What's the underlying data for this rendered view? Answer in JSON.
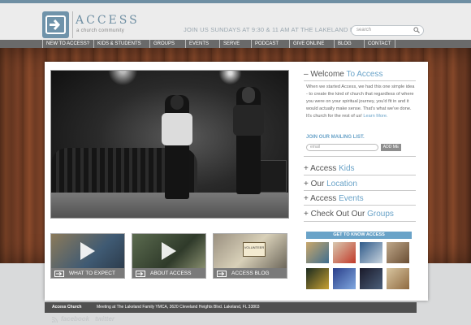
{
  "brand": {
    "name": "ACCESS",
    "subtitle": "a church community",
    "color": "#6f8fa3"
  },
  "header": {
    "tagline": "JOIN US SUNDAYS AT 9:30 & 11 AM AT THE LAKELAND FAMILY YMCA"
  },
  "search": {
    "placeholder": "search",
    "icon": "magnifier-icon"
  },
  "nav": [
    "NEW TO ACCESS?",
    "KIDS & STUDENTS",
    "GROUPS",
    "EVENTS",
    "SERVE",
    "PODCAST",
    "GIVE ONLINE",
    "BLOG",
    "CONTACT"
  ],
  "thumbs": [
    {
      "label": "WHAT TO EXPECT",
      "icon": "arrow-icon",
      "play": true
    },
    {
      "label": "ABOUT ACCESS",
      "icon": "arrow-icon",
      "play": true
    },
    {
      "label": "ACCESS BLOG",
      "icon": "arrow-icon",
      "badge": "VOLUNTEER"
    }
  ],
  "welcome": {
    "prefix": "– Welcome ",
    "accent": "To Access"
  },
  "intro": {
    "text": "When we started Access, we had this one simple idea - to create the kind of church that regardless of where you were on your spiritual journey, you'd fit in and it would actually make sense. That's what we've done. It's church for the rest of us!",
    "link": "Learn More."
  },
  "mailing": {
    "label": "JOIN OUR MAILING LIST.",
    "placeholder": "email",
    "button": "ADD ME"
  },
  "accordion": [
    {
      "prefix": "+ Access ",
      "accent": "Kids"
    },
    {
      "prefix": "+ Our ",
      "accent": "Location"
    },
    {
      "prefix": "+ Access ",
      "accent": "Events"
    },
    {
      "prefix": "+ Check Out Our ",
      "accent": "Groups"
    }
  ],
  "get_to_know": {
    "title": "GET TO KNOW ACCESS"
  },
  "footer": {
    "name": "Access Church",
    "address": "Meeting at The Lakeland Family YMCA, 3620 Cleveland Heights Blvd. Lakeland, FL 33803"
  },
  "social": [
    "facebook",
    "twitter"
  ],
  "accent_color": "#6aa3c8"
}
